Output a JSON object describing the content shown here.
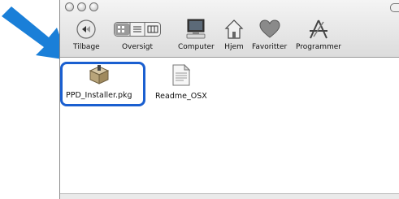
{
  "toolbar": {
    "back_label": "Tilbage",
    "view_label": "Oversigt",
    "computer_label": "Computer",
    "home_label": "Hjem",
    "favorites_label": "Favoritter",
    "applications_label": "Programmer"
  },
  "files": [
    {
      "name": "PPD_Installer.pkg",
      "icon": "package-icon",
      "selected": true
    },
    {
      "name": "Readme_OSX",
      "icon": "document-icon",
      "selected": false
    }
  ],
  "colors": {
    "arrow": "#1a7fd8",
    "highlight": "#1a5fd0"
  }
}
